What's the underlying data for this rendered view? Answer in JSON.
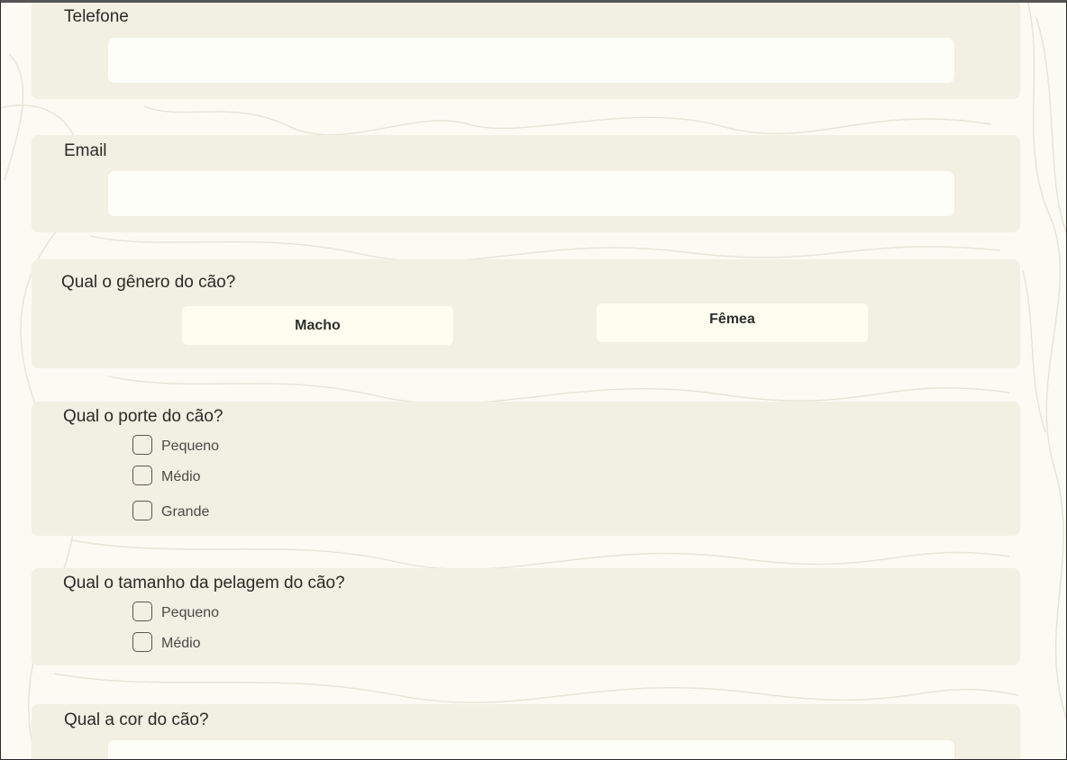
{
  "phone": {
    "label": "Telefone",
    "value": ""
  },
  "email": {
    "label": "Email",
    "value": ""
  },
  "gender": {
    "question": "Qual o gênero do cão?",
    "options": [
      "Macho",
      "Fêmea"
    ]
  },
  "size": {
    "question": "Qual o porte do cão?",
    "options": [
      "Pequeno",
      "Médio",
      "Grande"
    ]
  },
  "coat": {
    "question": "Qual o tamanho da pelagem do cão?",
    "options": [
      "Pequeno",
      "Médio"
    ]
  },
  "color": {
    "question": "Qual a cor do cão?",
    "value": ""
  },
  "theme": {
    "page_bg": "#fbfaf3",
    "card_bg": "#f2efe3",
    "input_bg": "#fefef8"
  }
}
